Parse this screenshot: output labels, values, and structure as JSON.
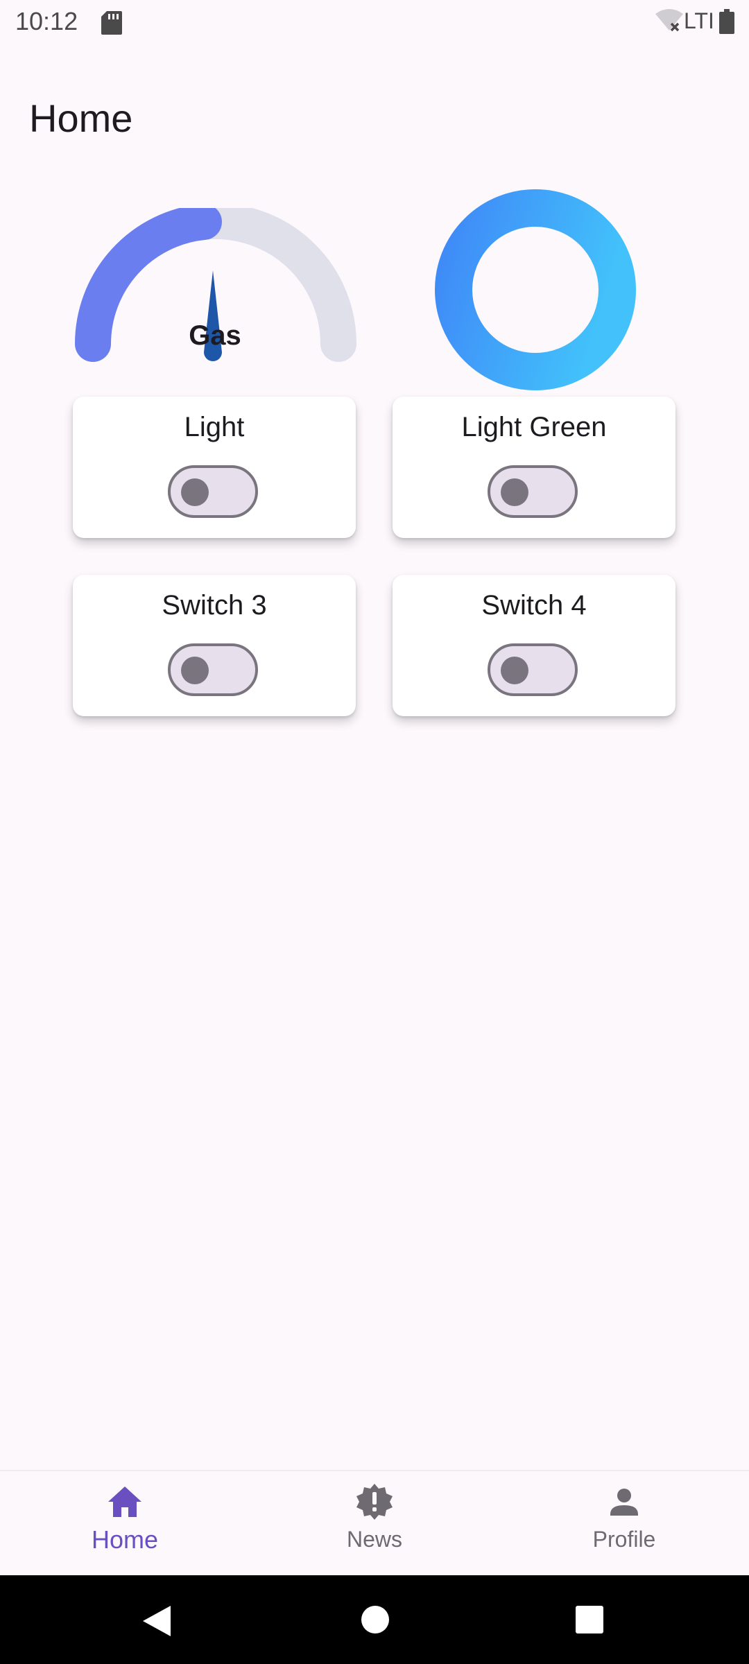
{
  "status_bar": {
    "time": "10:12",
    "network_label": "LTI",
    "icons": [
      "sd-card-icon",
      "wifi-off-icon",
      "battery-icon"
    ]
  },
  "page": {
    "title": "Home"
  },
  "gauge": {
    "label": "Gas",
    "value_fraction": 0.5,
    "colors": {
      "filled": "#6a7ef0",
      "track": "#dfe0ea",
      "needle": "#1e56a8"
    }
  },
  "donut": {
    "colors": {
      "start": "#3f8af7",
      "end": "#42c1fb"
    }
  },
  "cards": [
    {
      "label": "Light",
      "switch_on": false
    },
    {
      "label": "Light Green",
      "switch_on": false
    },
    {
      "label": "Switch 3",
      "switch_on": false
    },
    {
      "label": "Switch 4",
      "switch_on": false
    }
  ],
  "bottom_nav": {
    "active": "Home",
    "items": [
      {
        "label": "Home",
        "icon": "home-icon"
      },
      {
        "label": "News",
        "icon": "news-badge-icon"
      },
      {
        "label": "Profile",
        "icon": "person-icon"
      }
    ],
    "colors": {
      "active": "#6a4fc0",
      "inactive": "#6e6a72"
    }
  }
}
